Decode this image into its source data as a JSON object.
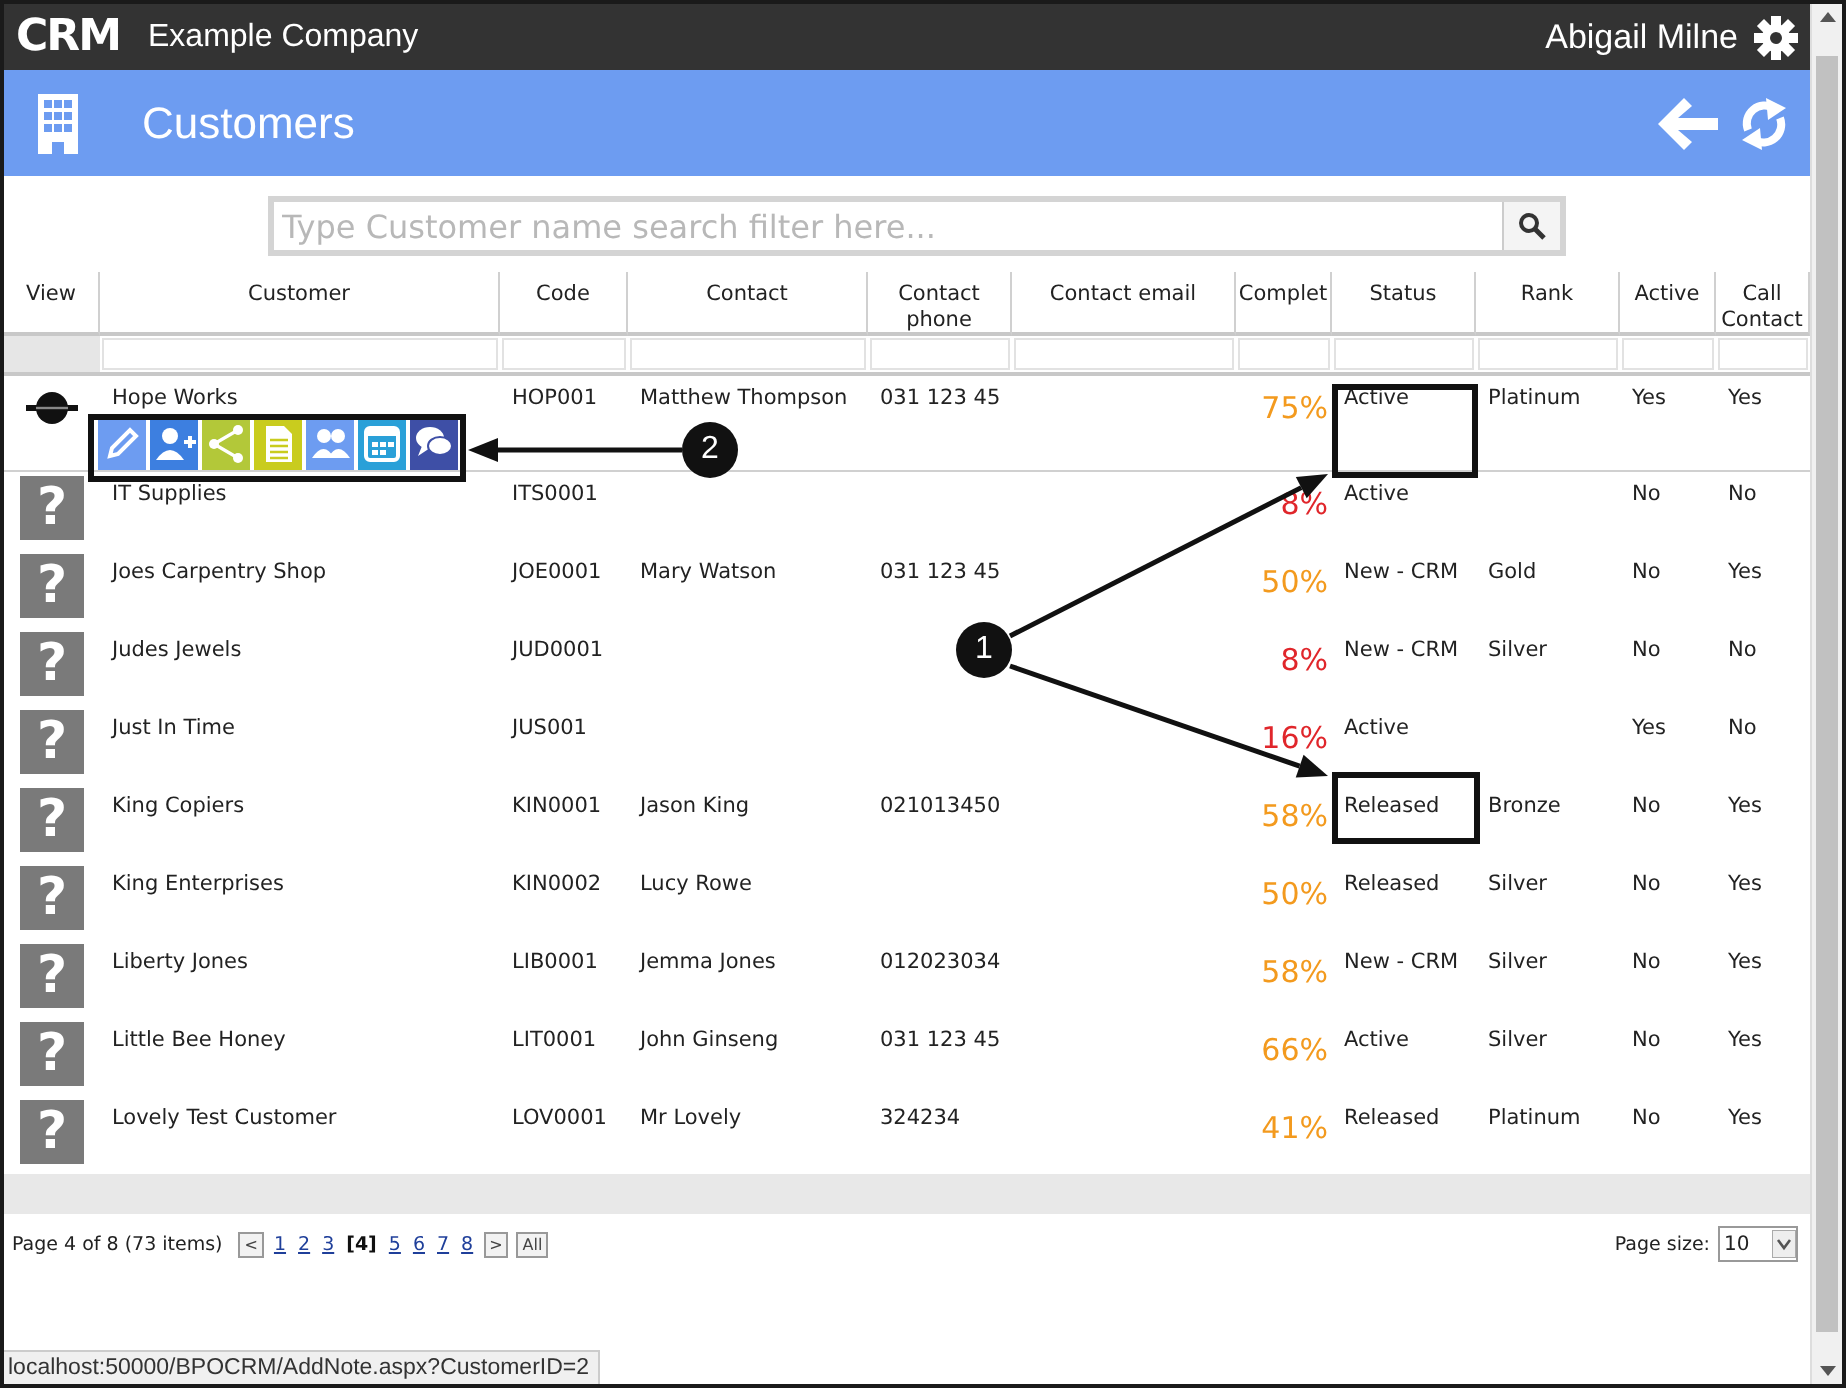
{
  "app": {
    "logo": "CRM",
    "company": "Example Company",
    "user": "Abigail Milne"
  },
  "page": {
    "title": "Customers"
  },
  "search": {
    "placeholder": "Type Customer name search filter here..."
  },
  "table": {
    "columns": [
      "View",
      "Customer",
      "Code",
      "Contact",
      "Contact phone",
      "Contact email",
      "Complet",
      "Status",
      "Rank",
      "Active",
      "Call Contact"
    ],
    "rows": [
      {
        "avatar": {
          "kind": "logo"
        },
        "customer": "Hope Works",
        "code": "HOP001",
        "contact": "Matthew Thompson",
        "phone": "031 123 45",
        "complete": {
          "text": "75%",
          "color": "#f39a1e"
        },
        "status": "Active",
        "rank": "Platinum",
        "active": "Yes",
        "call_contact": "Yes",
        "actions": [
          {
            "kind": "edit"
          },
          {
            "kind": "add-contact"
          },
          {
            "kind": "share"
          },
          {
            "kind": "document"
          },
          {
            "kind": "contacts"
          },
          {
            "kind": "calendar"
          },
          {
            "kind": "chat"
          }
        ]
      },
      {
        "avatar": {
          "kind": "placeholder",
          "glyph": "?"
        },
        "customer": "IT Supplies",
        "code": "ITS0001",
        "complete": {
          "text": "8%",
          "color": "#e0262b"
        },
        "status": "Active",
        "active": "No",
        "call_contact": "No"
      },
      {
        "avatar": {
          "kind": "placeholder",
          "glyph": "?"
        },
        "customer": "Joes Carpentry Shop",
        "code": "JOE0001",
        "contact": "Mary Watson",
        "phone": "031 123 45",
        "complete": {
          "text": "50%",
          "color": "#f39a1e"
        },
        "status": "New - CRM",
        "rank": "Gold",
        "active": "No",
        "call_contact": "Yes"
      },
      {
        "avatar": {
          "kind": "placeholder",
          "glyph": "?"
        },
        "customer": "Judes Jewels",
        "code": "JUD0001",
        "complete": {
          "text": "8%",
          "color": "#e0262b"
        },
        "status": "New - CRM",
        "rank": "Silver",
        "active": "No",
        "call_contact": "No"
      },
      {
        "avatar": {
          "kind": "placeholder",
          "glyph": "?"
        },
        "customer": "Just In Time",
        "code": "JUS001",
        "complete": {
          "text": "16%",
          "color": "#e0262b"
        },
        "status": "Active",
        "active": "Yes",
        "call_contact": "No"
      },
      {
        "avatar": {
          "kind": "placeholder",
          "glyph": "?"
        },
        "customer": "King Copiers",
        "code": "KIN0001",
        "contact": "Jason King",
        "phone": "021013450",
        "complete": {
          "text": "58%",
          "color": "#f39a1e"
        },
        "status": "Released",
        "rank": "Bronze",
        "active": "No",
        "call_contact": "Yes"
      },
      {
        "avatar": {
          "kind": "placeholder",
          "glyph": "?"
        },
        "customer": "King Enterprises",
        "code": "KIN0002",
        "contact": "Lucy Rowe",
        "complete": {
          "text": "50%",
          "color": "#f39a1e"
        },
        "status": "Released",
        "rank": "Silver",
        "active": "No",
        "call_contact": "Yes"
      },
      {
        "avatar": {
          "kind": "placeholder",
          "glyph": "?"
        },
        "customer": "Liberty Jones",
        "code": "LIB0001",
        "contact": "Jemma Jones",
        "phone": "012023034",
        "complete": {
          "text": "58%",
          "color": "#f39a1e"
        },
        "status": "New - CRM",
        "rank": "Silver",
        "active": "No",
        "call_contact": "Yes"
      },
      {
        "avatar": {
          "kind": "placeholder",
          "glyph": "?"
        },
        "customer": "Little Bee Honey",
        "code": "LIT0001",
        "contact": "John Ginseng",
        "phone": "031 123 45",
        "complete": {
          "text": "66%",
          "color": "#f39a1e"
        },
        "status": "Active",
        "rank": "Silver",
        "active": "No",
        "call_contact": "Yes"
      },
      {
        "avatar": {
          "kind": "placeholder",
          "glyph": "?"
        },
        "customer": "Lovely Test Customer",
        "code": "LOV0001",
        "contact": "Mr Lovely",
        "phone": "324234",
        "complete": {
          "text": "41%",
          "color": "#f39a1e"
        },
        "status": "Released",
        "rank": "Platinum",
        "active": "No",
        "call_contact": "Yes"
      }
    ]
  },
  "pager": {
    "summary": "Page 4 of 8 (73 items)",
    "prev": "<",
    "pages": [
      {
        "label": "1",
        "selected": false
      },
      {
        "label": "2",
        "selected": false
      },
      {
        "label": "3",
        "selected": false
      },
      {
        "label": "[4]",
        "selected": true
      },
      {
        "label": "5",
        "selected": false
      },
      {
        "label": "6",
        "selected": false
      },
      {
        "label": "7",
        "selected": false
      },
      {
        "label": "8",
        "selected": false
      }
    ],
    "next": ">",
    "all": "All",
    "size_label": "Page size:",
    "size": "10"
  },
  "status_url": "localhost:50000/BPOCRM/AddNote.aspx?CustomerID=2",
  "callouts": [
    {
      "label": "1"
    },
    {
      "label": "2"
    }
  ]
}
